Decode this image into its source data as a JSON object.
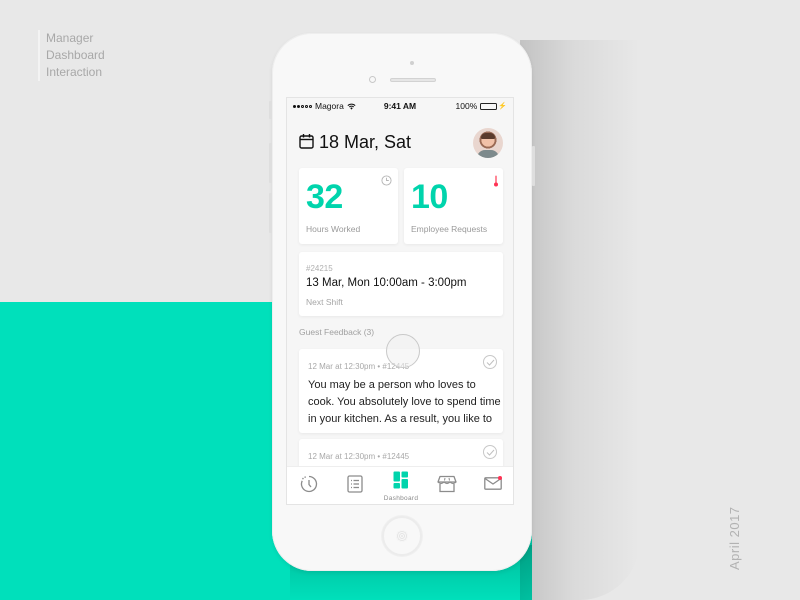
{
  "caption": {
    "lines": [
      "Manager",
      "Dashboard",
      "Interaction"
    ]
  },
  "date_label": "April 2017",
  "colors": {
    "accent": "#00e0bb",
    "stat_number": "#00d4ac",
    "notification": "#ff3355",
    "battery": "#2fd457"
  },
  "status_bar": {
    "carrier": "Magora",
    "time": "9:41 AM",
    "battery": "100%",
    "signal_bars_filled": 2,
    "signal_bars_total": 5
  },
  "header": {
    "calendar_icon": "calendar-icon",
    "title": "18 Mar, Sat",
    "avatar": "user-avatar"
  },
  "stats": [
    {
      "value": "32",
      "label": "Hours Worked",
      "icon": "clock-icon"
    },
    {
      "value": "10",
      "label": "Employee Requests",
      "icon": "thermometer-icon"
    }
  ],
  "next_shift": {
    "id": "#24215",
    "when": "13 Mar, Mon 10:00am - 3:00pm",
    "label": "Next Shift"
  },
  "feedback": {
    "section_label": "Guest Feedback (3)",
    "items": [
      {
        "meta": "12 Mar at 12:30pm  • #12445",
        "text": "You may be a person who loves to cook. You absolutely love to spend time in your kitchen. As a result, you like to",
        "icon": "check-circle-icon"
      },
      {
        "meta": "12 Mar at 12:30pm  • #12445",
        "text": "",
        "icon": "check-circle-icon"
      }
    ]
  },
  "tabbar": {
    "items": [
      {
        "icon": "clock-dashed-icon",
        "label": ""
      },
      {
        "icon": "list-icon",
        "label": ""
      },
      {
        "icon": "dashboard-icon",
        "label": "Dashboard",
        "active": true
      },
      {
        "icon": "store-icon",
        "label": ""
      },
      {
        "icon": "mail-icon",
        "label": "",
        "badge": true
      }
    ]
  }
}
